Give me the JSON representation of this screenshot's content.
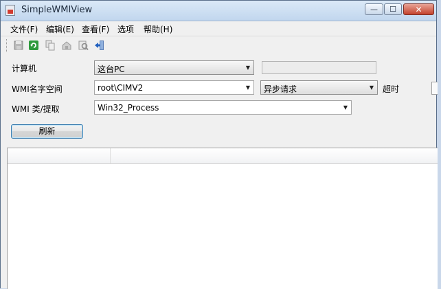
{
  "window": {
    "title": "SimpleWMIView",
    "app_icon": "wmi-app-icon",
    "minimize_glyph": "—",
    "maximize_glyph": "☐",
    "close_glyph": "✕"
  },
  "menu": [
    "文件(F)",
    "编辑(E)",
    "查看(F)",
    "选项",
    "帮助(H)"
  ],
  "toolbar": {
    "icons": [
      "save-icon",
      "refresh-icon",
      "copy-icon",
      "html-report-icon",
      "properties-icon",
      "exit-icon"
    ]
  },
  "form": {
    "computer_label": "计算机",
    "computer_value": "这台PC",
    "remote_computer_value": "",
    "namespace_label": "WMI名字空间",
    "namespace_value": "root\\CIMV2",
    "request_mode_value": "异步请求",
    "timeout_label": "超时",
    "class_label": "WMI 类/提取",
    "class_value": "Win32_Process",
    "refresh_label": "刷新"
  },
  "results": {
    "columns": [
      "",
      ""
    ],
    "rows": []
  }
}
